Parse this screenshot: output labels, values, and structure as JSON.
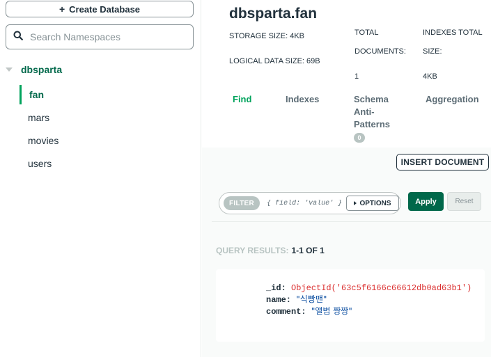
{
  "sidebar": {
    "create_label": "Create Database",
    "create_icon": "plus-icon",
    "search_placeholder": "Search Namespaces",
    "database": "dbsparta",
    "collections": [
      "fan",
      "mars",
      "movies",
      "users"
    ],
    "active_collection": "fan"
  },
  "header": {
    "title": "dbsparta.fan",
    "storage_size": "STORAGE SIZE: 4KB",
    "logical_size": "LOGICAL DATA SIZE: 69B",
    "total_docs_label_1": "TOTAL",
    "total_docs_label_2": "DOCUMENTS:",
    "total_docs_value": "1",
    "indexes_label_1": "INDEXES TOTAL",
    "indexes_label_2": "SIZE:",
    "indexes_value": "4KB"
  },
  "tabs": {
    "find": "Find",
    "indexes": "Indexes",
    "schema_1": "Schema",
    "schema_2": "Anti-",
    "schema_3": "Patterns",
    "schema_badge": "0",
    "aggregation": "Aggregation"
  },
  "toolbar": {
    "insert_label": "INSERT DOCUMENT",
    "filter_label": "FILTER",
    "filter_placeholder": "{ field: 'value' }",
    "options_label": "OPTIONS",
    "apply_label": "Apply",
    "reset_label": "Reset"
  },
  "results": {
    "label": "QUERY RESULTS:",
    "count": "1-1 OF 1"
  },
  "document": {
    "id_key": "_id:",
    "id_value": "ObjectId('63c5f6166c66612db0ad63b1')",
    "name_key": "name:",
    "name_value": "\"식빵맨\"",
    "comment_key": "comment:",
    "comment_value": "\"앨범 짱짱\""
  },
  "colors": {
    "brand_green": "#00684a",
    "active_green": "#00a35c",
    "objectid_red": "#db3030",
    "string_blue": "#0d4fa1"
  }
}
